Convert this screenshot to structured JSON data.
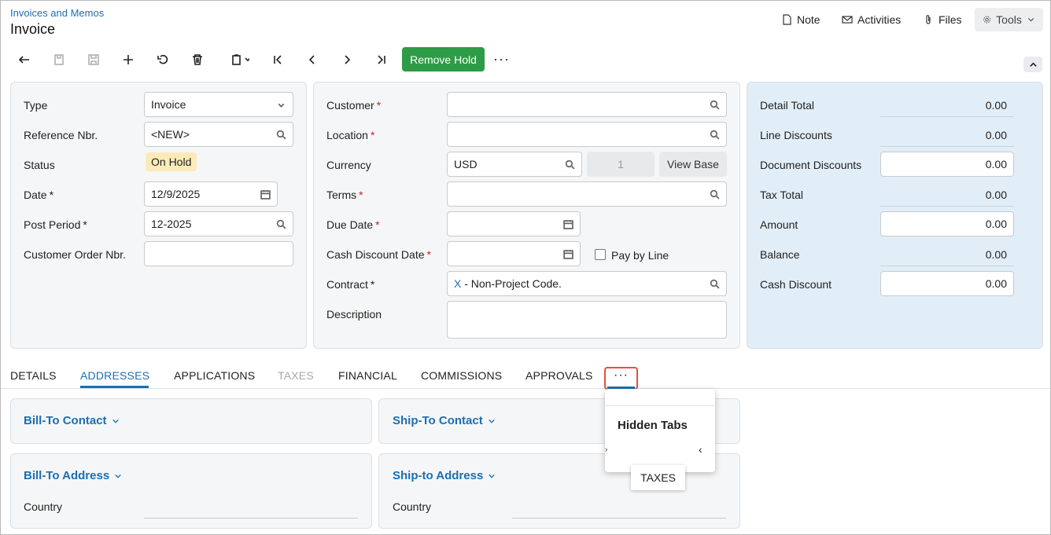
{
  "header": {
    "breadcrumb": "Invoices and Memos",
    "title": "Invoice"
  },
  "top_actions": {
    "note": "Note",
    "activities": "Activities",
    "files": "Files",
    "tools": "Tools"
  },
  "toolbar": {
    "remove_hold": "Remove Hold",
    "more": "···"
  },
  "summary": {
    "type_label": "Type",
    "type_value": "Invoice",
    "ref_label": "Reference Nbr.",
    "ref_value": "<NEW>",
    "status_label": "Status",
    "status_value": "On Hold",
    "date_label": "Date",
    "date_value": "12/9/2025",
    "period_label": "Post Period",
    "period_value": "12-2025",
    "order_label": "Customer Order Nbr.",
    "order_value": ""
  },
  "customer": {
    "customer_label": "Customer",
    "location_label": "Location",
    "currency_label": "Currency",
    "currency_value": "USD",
    "rate_value": "1",
    "view_base": "View Base",
    "terms_label": "Terms",
    "due_label": "Due Date",
    "cash_disc_label": "Cash Discount Date",
    "pay_by_line": "Pay by Line",
    "contract_label": "Contract",
    "contract_x": "X",
    "contract_value": " - Non-Project Code.",
    "desc_label": "Description",
    "desc_value": ""
  },
  "totals": {
    "detail_total_label": "Detail Total",
    "detail_total": "0.00",
    "line_disc_label": "Line Discounts",
    "line_disc": "0.00",
    "doc_disc_label": "Document Discounts",
    "doc_disc": "0.00",
    "tax_total_label": "Tax Total",
    "tax_total": "0.00",
    "amount_label": "Amount",
    "amount": "0.00",
    "balance_label": "Balance",
    "balance": "0.00",
    "cash_disc_label": "Cash Discount",
    "cash_disc": "0.00"
  },
  "tabs": [
    "DETAILS",
    "ADDRESSES",
    "APPLICATIONS",
    "TAXES",
    "FINANCIAL",
    "COMMISSIONS",
    "APPROVALS"
  ],
  "tabs_more": "···",
  "sections": {
    "bill_contact": "Bill-To Contact",
    "ship_contact": "Ship-To Contact",
    "bill_address": "Bill-To Address",
    "ship_address": "Ship-to Address",
    "country": "Country"
  },
  "popup": {
    "title": "Hidden Tabs",
    "item": "TAXES"
  },
  "colors": {
    "accent": "#1a6fb3",
    "success": "#2e9b46",
    "required": "#c0262b",
    "highlight": "#e4513a"
  }
}
